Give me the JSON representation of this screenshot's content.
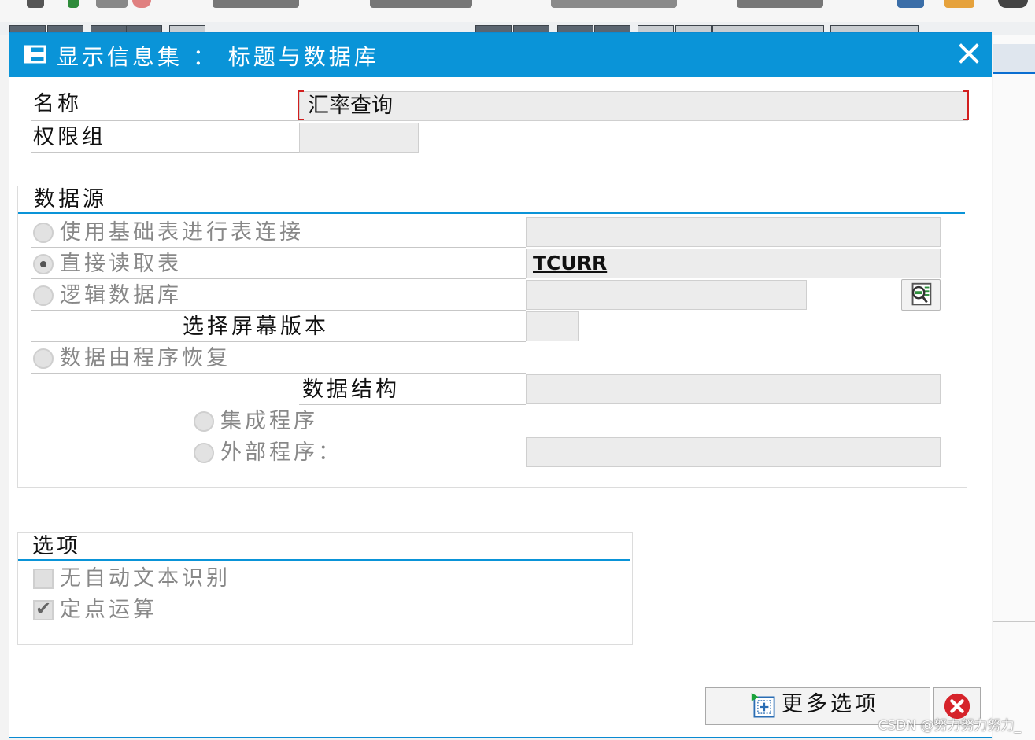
{
  "dialog": {
    "title": "显示信息集 ： 标题与数据库",
    "close_icon": "close-icon"
  },
  "header": {
    "name_label": "名称",
    "name_value": "汇率查询",
    "auth_group_label": "权限组",
    "auth_group_value": ""
  },
  "data_source": {
    "title": "数据源",
    "options": [
      {
        "label": "使用基础表进行表连接",
        "selected": false,
        "value": ""
      },
      {
        "label": "直接读取表",
        "selected": true,
        "value": "TCURR"
      },
      {
        "label": "逻辑数据库",
        "selected": false,
        "value": ""
      }
    ],
    "screen_version_label": "选择屏幕版本",
    "screen_version_value": "",
    "program_option_label": "数据由程序恢复",
    "data_structure_label": "数据结构",
    "data_structure_value": "",
    "sub_options": [
      {
        "label": "集成程序",
        "selected": false
      },
      {
        "label": "外部程序：",
        "selected": false,
        "value": ""
      }
    ]
  },
  "options": {
    "title": "选项",
    "checkboxes": [
      {
        "label": "无自动文本识别",
        "checked": false
      },
      {
        "label": "定点运算",
        "checked": true
      }
    ]
  },
  "footer": {
    "more_options_label": "更多选项",
    "cancel_icon": "cancel-icon"
  },
  "watermark": "CSDN @努力努力努力_",
  "colors": {
    "title_bar": "#0a94d8",
    "focus_marker": "#d21f1f",
    "cancel_red": "#d6232a"
  }
}
